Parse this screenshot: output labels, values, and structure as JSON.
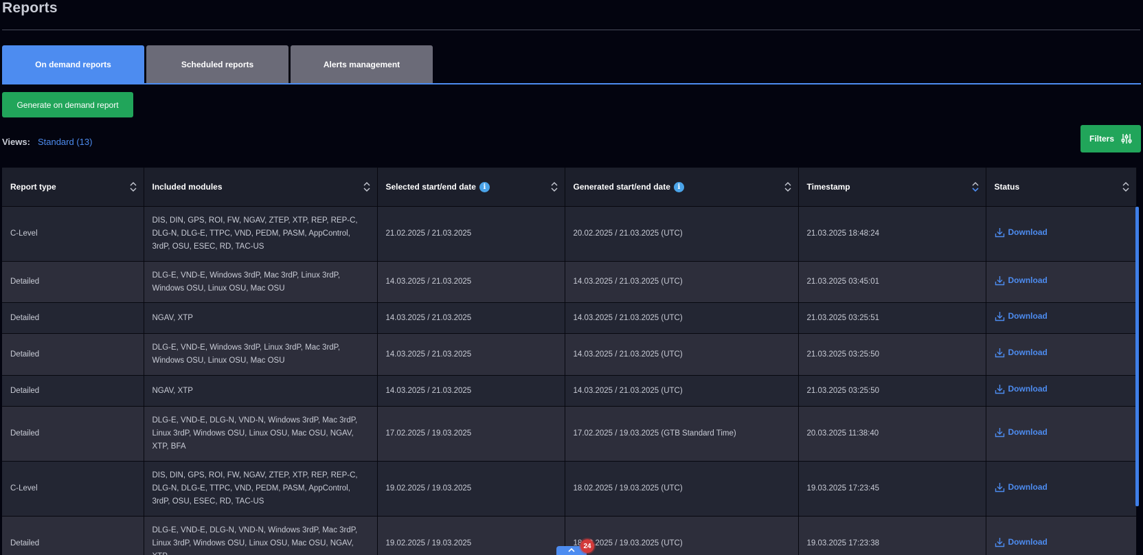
{
  "page": {
    "title": "Reports"
  },
  "tabs": [
    {
      "label": "On demand reports",
      "active": true
    },
    {
      "label": "Scheduled reports",
      "active": false
    },
    {
      "label": "Alerts management",
      "active": false
    }
  ],
  "actions": {
    "generate_label": "Generate on demand report",
    "filters_label": "Filters"
  },
  "views": {
    "label": "Views:",
    "value": "Standard (13)"
  },
  "table": {
    "columns": [
      {
        "label": "Report type",
        "info": false
      },
      {
        "label": "Included modules",
        "info": false
      },
      {
        "label": "Selected start/end date",
        "info": true
      },
      {
        "label": "Generated start/end date",
        "info": true
      },
      {
        "label": "Timestamp",
        "info": false
      },
      {
        "label": "Status",
        "info": false
      }
    ],
    "rows": [
      {
        "type": "C-Level",
        "modules": "DIS, DIN, GPS, ROI, FW, NGAV, ZTEP, XTP, REP, REP-C, DLG-N, DLG-E, TTPC, VND, PEDM, PASM, AppControl, 3rdP, OSU, ESEC, RD, TAC-US",
        "selected": "21.02.2025 / 21.03.2025",
        "generated": "20.02.2025 / 21.03.2025 (UTC)",
        "timestamp": "21.03.2025  18:48:24",
        "status": "Download"
      },
      {
        "type": "Detailed",
        "modules": "DLG-E, VND-E, Windows 3rdP, Mac 3rdP, Linux 3rdP, Windows OSU, Linux OSU, Mac OSU",
        "selected": "14.03.2025 / 21.03.2025",
        "generated": "14.03.2025 / 21.03.2025 (UTC)",
        "timestamp": "21.03.2025  03:45:01",
        "status": "Download"
      },
      {
        "type": "Detailed",
        "modules": "NGAV, XTP",
        "selected": "14.03.2025 / 21.03.2025",
        "generated": "14.03.2025 / 21.03.2025 (UTC)",
        "timestamp": "21.03.2025  03:25:51",
        "status": "Download"
      },
      {
        "type": "Detailed",
        "modules": "DLG-E, VND-E, Windows 3rdP, Linux 3rdP, Mac 3rdP, Windows OSU, Linux OSU, Mac OSU",
        "selected": "14.03.2025 / 21.03.2025",
        "generated": "14.03.2025 / 21.03.2025 (UTC)",
        "timestamp": "21.03.2025  03:25:50",
        "status": "Download"
      },
      {
        "type": "Detailed",
        "modules": "NGAV, XTP",
        "selected": "14.03.2025 / 21.03.2025",
        "generated": "14.03.2025 / 21.03.2025 (UTC)",
        "timestamp": "21.03.2025  03:25:50",
        "status": "Download"
      },
      {
        "type": "Detailed",
        "modules": "DLG-E, VND-E, DLG-N, VND-N, Windows 3rdP, Mac 3rdP, Linux 3rdP, Windows OSU, Linux OSU, Mac OSU, NGAV, XTP, BFA",
        "selected": "17.02.2025 / 19.03.2025",
        "generated": "17.02.2025 / 19.03.2025 (GTB Standard Time)",
        "timestamp": "20.03.2025  11:38:40",
        "status": "Download"
      },
      {
        "type": "C-Level",
        "modules": "DIS, DIN, GPS, ROI, FW, NGAV, ZTEP, XTP, REP, REP-C, DLG-N, DLG-E, TTPC, VND, PEDM, PASM, AppControl, 3rdP, OSU, ESEC, RD, TAC-US",
        "selected": "19.02.2025 / 19.03.2025",
        "generated": "18.02.2025 / 19.03.2025 (UTC)",
        "timestamp": "19.03.2025  17:23:45",
        "status": "Download"
      },
      {
        "type": "Detailed",
        "modules": "DLG-E, VND-E, DLG-N, VND-N, Windows 3rdP, Mac 3rdP, Linux 3rdP, Windows OSU, Linux OSU, Mac OSU, NGAV, XTP,",
        "selected": "19.02.2025 / 19.03.2025",
        "generated": "18.02.2025 / 19.03.2025 (UTC)",
        "timestamp": "19.03.2025  17:23:38",
        "status": "Download"
      }
    ]
  },
  "notifications": {
    "count": "24"
  },
  "colors": {
    "accent": "#4d8cf0",
    "success": "#21a55a",
    "background": "#03040f",
    "badge": "#d33a3a"
  },
  "icons": [
    "sort-icon",
    "sort-down-icon",
    "info-icon",
    "download-icon",
    "sliders-icon",
    "chevron-up-icon"
  ]
}
